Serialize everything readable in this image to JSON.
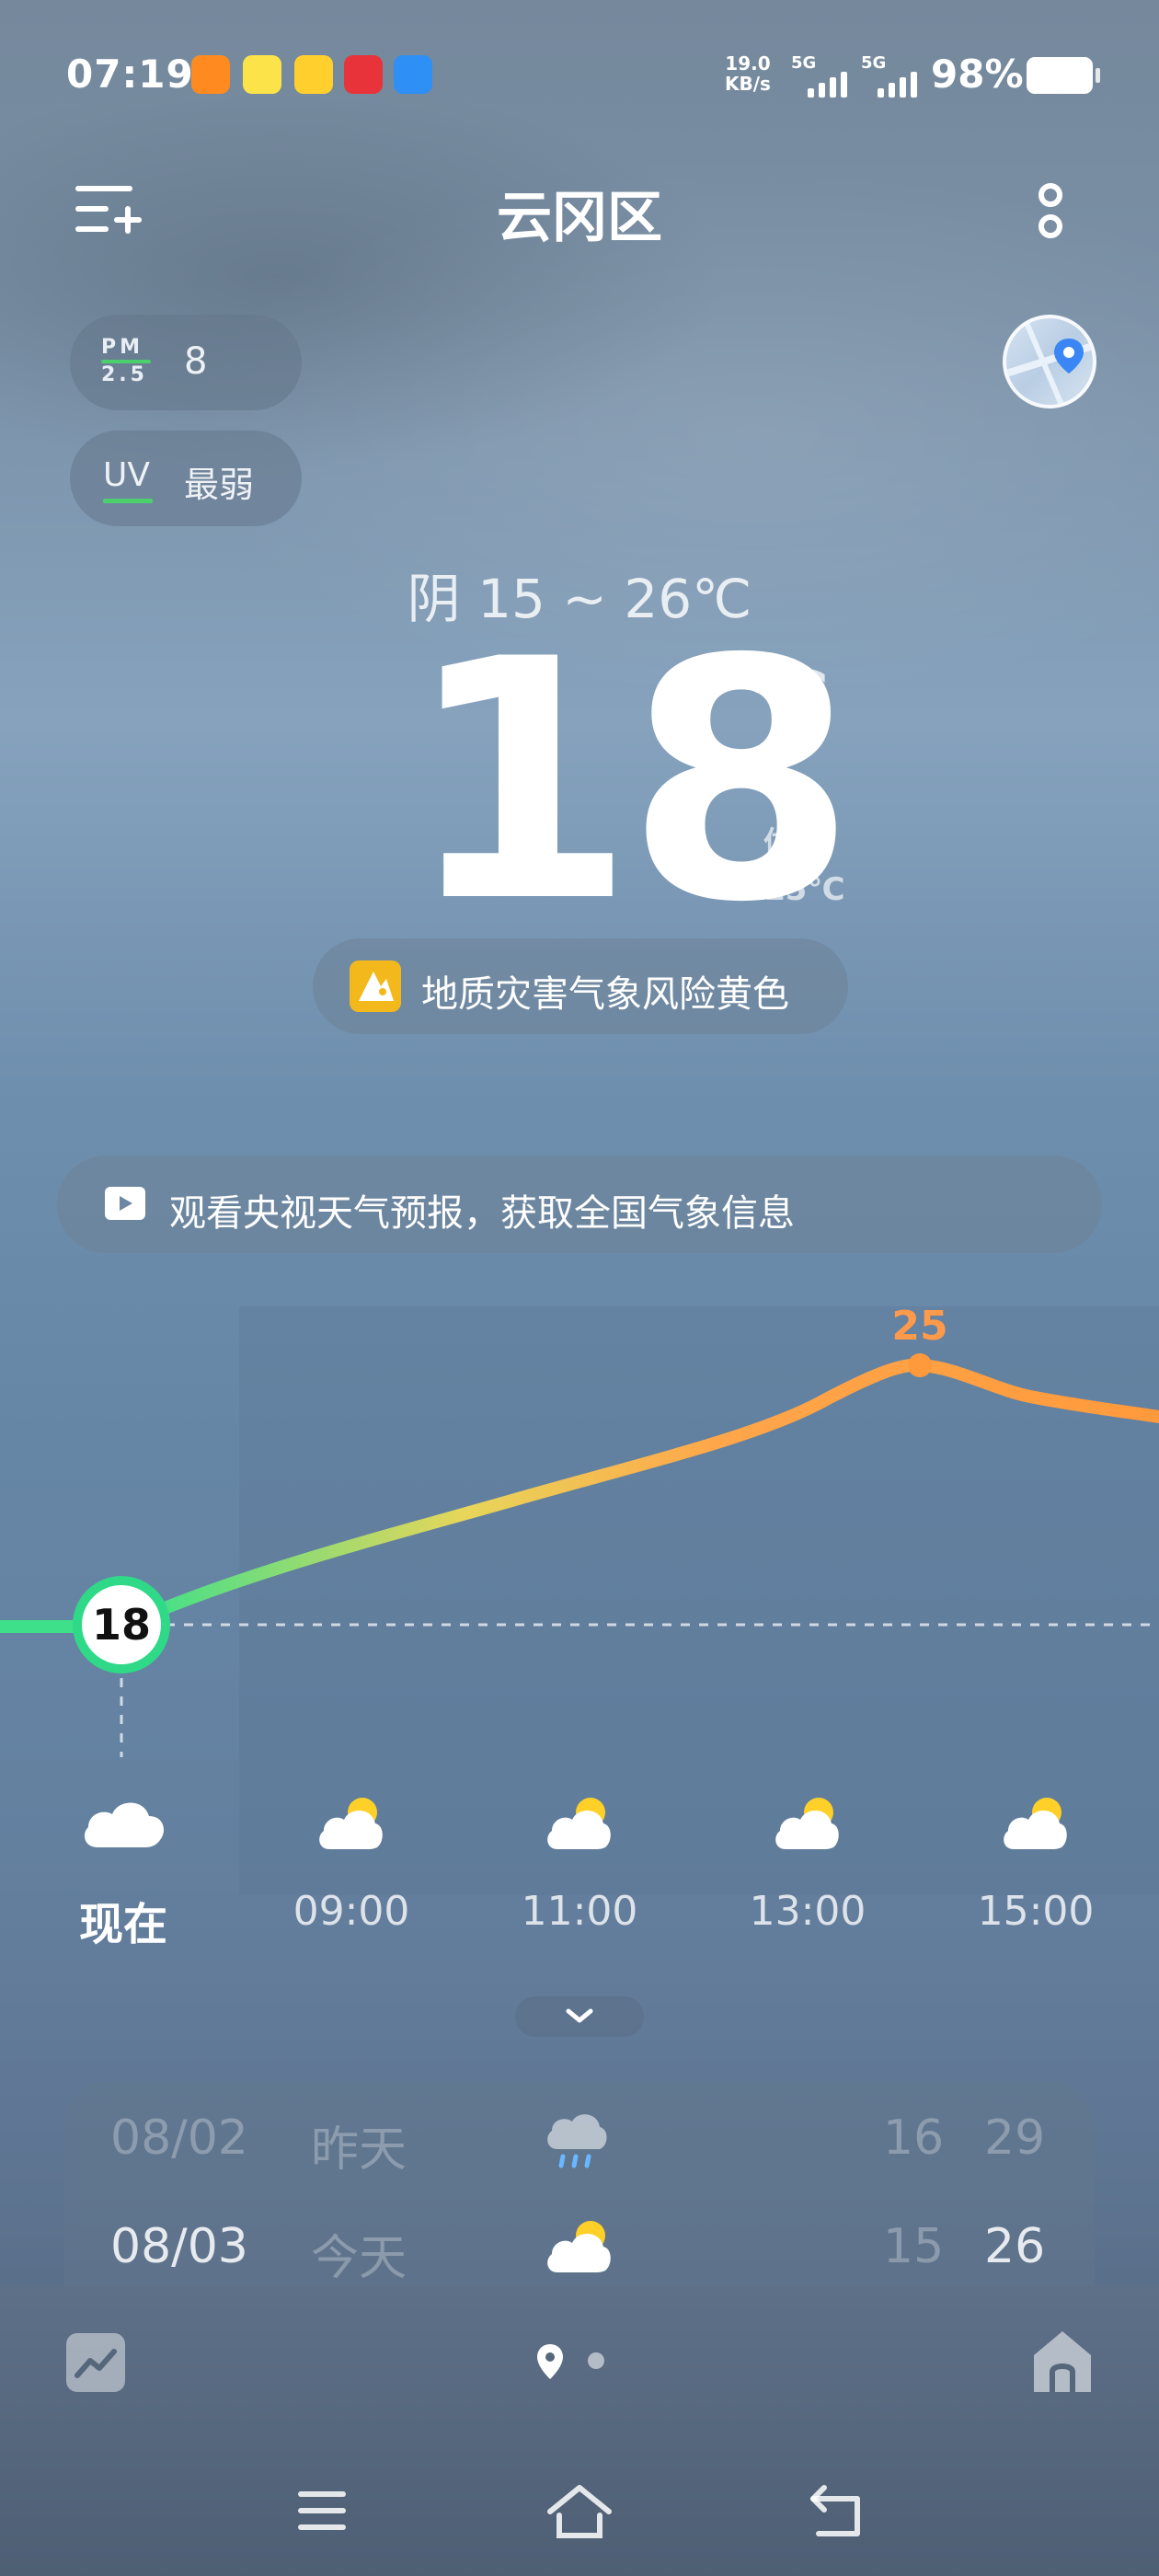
{
  "status_bar": {
    "time": "07:19",
    "net_speed_value": "19.0",
    "net_speed_unit": "KB/s",
    "sim1": "5G",
    "sim2": "5G",
    "battery": "98%"
  },
  "header": {
    "title": "云冈区"
  },
  "air": {
    "pm_label_top": "PM",
    "pm_label_bottom": "2.5",
    "pm_value": "8",
    "uv_label": "UV",
    "uv_value": "最弱"
  },
  "current": {
    "condition_range": "阴  15 ~ 26℃",
    "temperature": "18",
    "unit": "℃",
    "feels_label": "体感",
    "feels_value": "15℃"
  },
  "alert": {
    "text": "地质灾害气象风险黄色"
  },
  "banner": {
    "text": "观看央视天气预报，获取全国气象信息"
  },
  "chart_data": {
    "type": "line",
    "x": [
      "现在",
      "09:00",
      "11:00",
      "13:00",
      "15:00"
    ],
    "current_value_label": "18",
    "peak_label": "25",
    "values": [
      18,
      20,
      22,
      24,
      25,
      23
    ]
  },
  "hourly": [
    {
      "time": "现在",
      "icon": "cloud-icon"
    },
    {
      "time": "09:00",
      "icon": "partly-sunny-icon"
    },
    {
      "time": "11:00",
      "icon": "partly-sunny-icon"
    },
    {
      "time": "13:00",
      "icon": "partly-sunny-icon"
    },
    {
      "time": "15:00",
      "icon": "partly-sunny-icon"
    }
  ],
  "daily": [
    {
      "date": "08/02",
      "day": "昨天",
      "icon": "rain-icon",
      "low": "16",
      "high": "29"
    },
    {
      "date": "08/03",
      "day": "今天",
      "icon": "partly-sunny-icon",
      "low": "15",
      "high": "26"
    }
  ],
  "colors": {
    "curve_start": "#3ee08a",
    "curve_end": "#ff9a3c",
    "peak_label": "#ff9a4a",
    "uv_line": "#4cd06e",
    "alert_icon": "#f3b81c"
  }
}
